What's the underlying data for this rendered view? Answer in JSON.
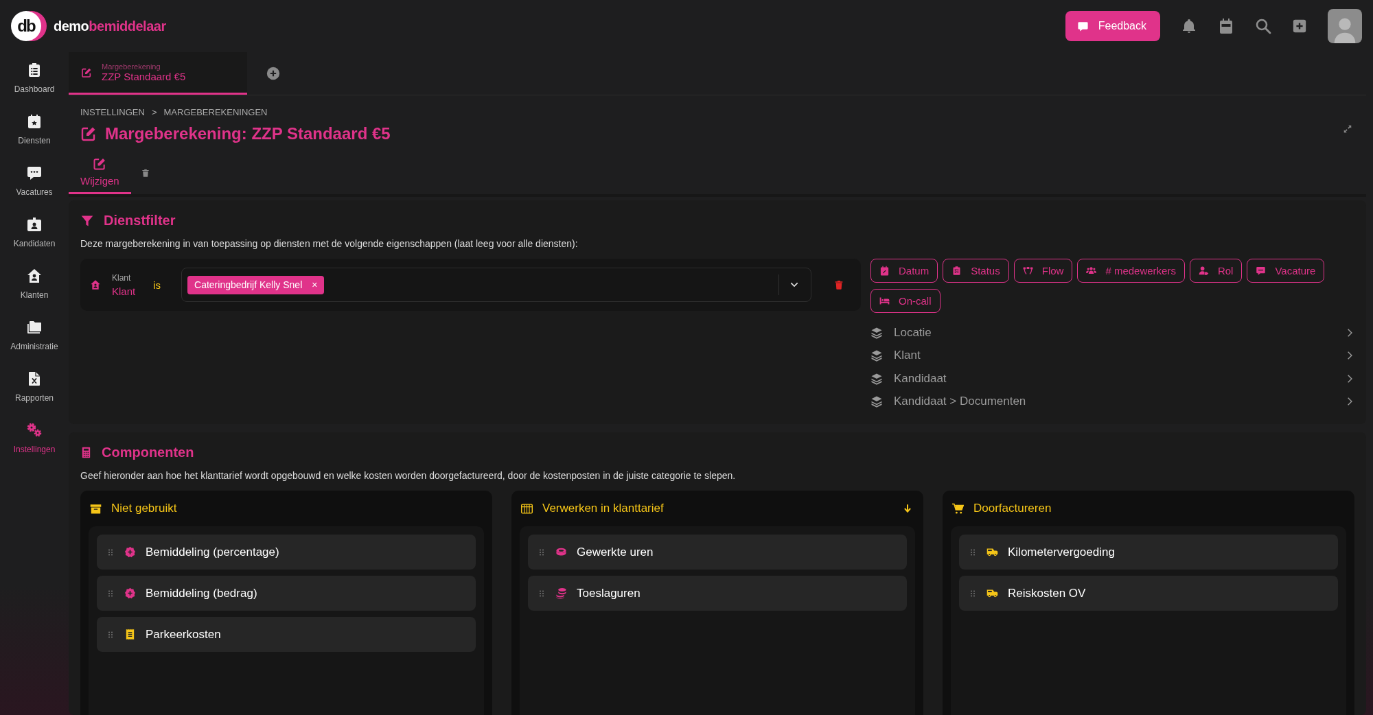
{
  "header": {
    "logo_mark": "db",
    "wordmark_start": "demo",
    "wordmark_end": "bemiddelaar",
    "feedback_button": "Feedback"
  },
  "sidebar": {
    "items": [
      {
        "label": "Dashboard",
        "selected": false
      },
      {
        "label": "Diensten",
        "selected": false
      },
      {
        "label": "Vacatures",
        "selected": false
      },
      {
        "label": "Kandidaten",
        "selected": false
      },
      {
        "label": "Klanten",
        "selected": false
      },
      {
        "label": "Administratie",
        "selected": false
      },
      {
        "label": "Rapporten",
        "selected": false
      },
      {
        "label": "Instellingen",
        "selected": true
      }
    ]
  },
  "tabs": [
    {
      "caption": "Margeberekening",
      "label": "ZZP Standaard €5",
      "selected": true
    }
  ],
  "breadcrumb": [
    "INSTELLINGEN",
    ">",
    "MARGEBEREKENINGEN"
  ],
  "page_title": "Margeberekening: ZZP Standaard €5",
  "sub_tabs": [
    {
      "label": "Wijzigen",
      "selected": true
    },
    {
      "selected": false
    }
  ],
  "dienstfilter": {
    "title": "Dienstfilter",
    "description": "Deze margeberekening in van toepassing op diensten met de volgende eigenschappen (laat leeg voor alle diensten):",
    "conditions": [
      {
        "field_caption": "Klant",
        "field": "Klant",
        "operator": "is",
        "values": [
          {
            "label": "Cateringbedrijf Kelly Snel",
            "remove": "×"
          }
        ]
      }
    ],
    "add_buttons": [
      "Datum",
      "Status",
      "Flow",
      "# medewerkers",
      "Rol",
      "Vacature",
      "On-call"
    ],
    "groups": [
      "Locatie",
      "Klant",
      "Kandidaat",
      "Kandidaat > Documenten"
    ]
  },
  "componenten": {
    "title": "Componenten",
    "description": "Geef hieronder aan hoe het klanttarief wordt opgebouwd en welke kosten worden doorgefactureerd, door de kostenposten in de juiste categorie te slepen.",
    "columns": [
      {
        "title": "Niet gebruikt",
        "items": [
          {
            "label": "Bemiddeling (percentage)",
            "color": "#e0338a"
          },
          {
            "label": "Bemiddeling (bedrag)",
            "color": "#e0338a"
          },
          {
            "label": "Parkeerkosten",
            "color": "#f5c518"
          }
        ]
      },
      {
        "title": "Verwerken in klanttarief",
        "items": [
          {
            "label": "Gewerkte uren",
            "color": "#e0338a"
          },
          {
            "label": "Toeslaguren",
            "color": "#e0338a"
          }
        ]
      },
      {
        "title": "Doorfactureren",
        "items": [
          {
            "label": "Kilometervergoeding",
            "color": "#f5c518"
          },
          {
            "label": "Reiskosten OV",
            "color": "#f5c518"
          }
        ]
      }
    ]
  }
}
